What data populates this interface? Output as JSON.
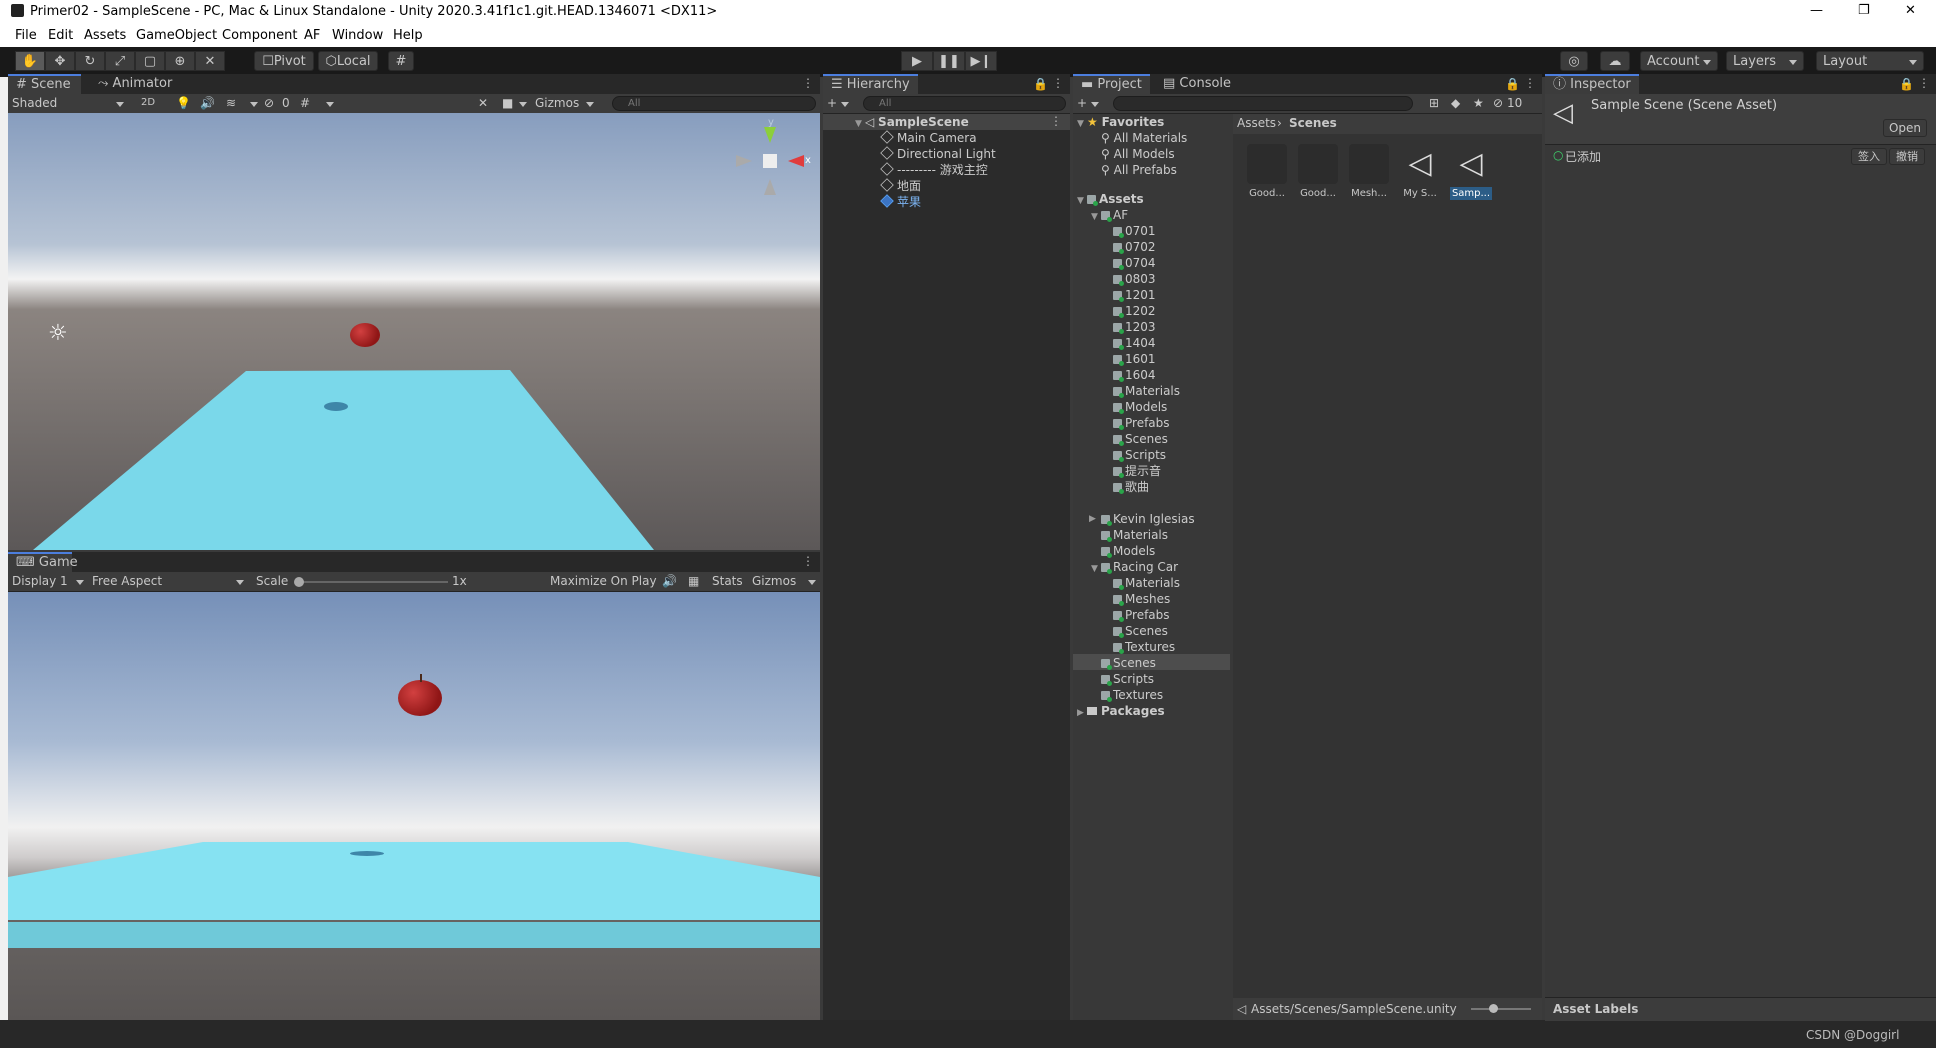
{
  "window": {
    "title": "Primer02 - SampleScene - PC, Mac & Linux Standalone - Unity 2020.3.41f1c1.git.HEAD.1346071 <DX11>",
    "controls": [
      "—",
      "❐",
      "✕"
    ]
  },
  "menu": [
    "File",
    "Edit",
    "Assets",
    "GameObject",
    "Component",
    "AF",
    "Window",
    "Help"
  ],
  "toolbar": {
    "pivot_label": "Pivot",
    "local_label": "Local",
    "account_label": "Account",
    "layers_label": "Layers",
    "layout_label": "Layout"
  },
  "scene_panel": {
    "tabs": [
      "Scene",
      "Animator"
    ],
    "shading_mode": "Shaded",
    "mode_2d": "2D",
    "hidden_count": "0",
    "gizmos_label": "Gizmos",
    "search_placeholder": "All",
    "axis_y": "y",
    "axis_x": "x"
  },
  "game_panel": {
    "tab": "Game",
    "display": "Display 1",
    "aspect": "Free Aspect",
    "scale_label": "Scale",
    "scale_value": "1x",
    "maximize_label": "Maximize On Play",
    "stats_label": "Stats",
    "gizmos_label": "Gizmos"
  },
  "hierarchy": {
    "tab": "Hierarchy",
    "search_placeholder": "All",
    "scene_name": "SampleScene",
    "items": [
      "Main Camera",
      "Directional Light",
      "--------- 游戏主控",
      "地面",
      "苹果"
    ]
  },
  "project": {
    "tabs": [
      "Project",
      "Console"
    ],
    "hidden_count": "10",
    "favorites_label": "Favorites",
    "favorites": [
      "All Materials",
      "All Models",
      "All Prefabs"
    ],
    "assets_label": "Assets",
    "af_label": "AF",
    "af_children": [
      "0701",
      "0702",
      "0704",
      "0803",
      "1201",
      "1202",
      "1203",
      "1404",
      "1601",
      "1604",
      "Materials",
      "Models",
      "Prefabs",
      "Scenes",
      "Scripts",
      "提示音",
      "歌曲"
    ],
    "assets_mid": [
      "Kevin Iglesias",
      "Materials",
      "Models"
    ],
    "racing_car_label": "Racing Car",
    "racing_children": [
      "Materials",
      "Meshes",
      "Prefabs",
      "Scenes",
      "Textures"
    ],
    "assets_tail": [
      "Scenes",
      "Scripts",
      "Textures"
    ],
    "packages_label": "Packages",
    "breadcrumb": [
      "Assets",
      "Scenes"
    ],
    "files": [
      "Good...",
      "Good...",
      "Mesh...",
      "My S...",
      "Samp..."
    ],
    "status_path": "Assets/Scenes/SampleScene.unity"
  },
  "inspector": {
    "tab": "Inspector",
    "asset_title": "Sample Scene (Scene Asset)",
    "open_label": "Open",
    "added_label": "已添加",
    "checkin_label": "签入",
    "revert_label": "撤销",
    "asset_labels": "Asset Labels"
  },
  "watermark": "CSDN @Doggirl"
}
